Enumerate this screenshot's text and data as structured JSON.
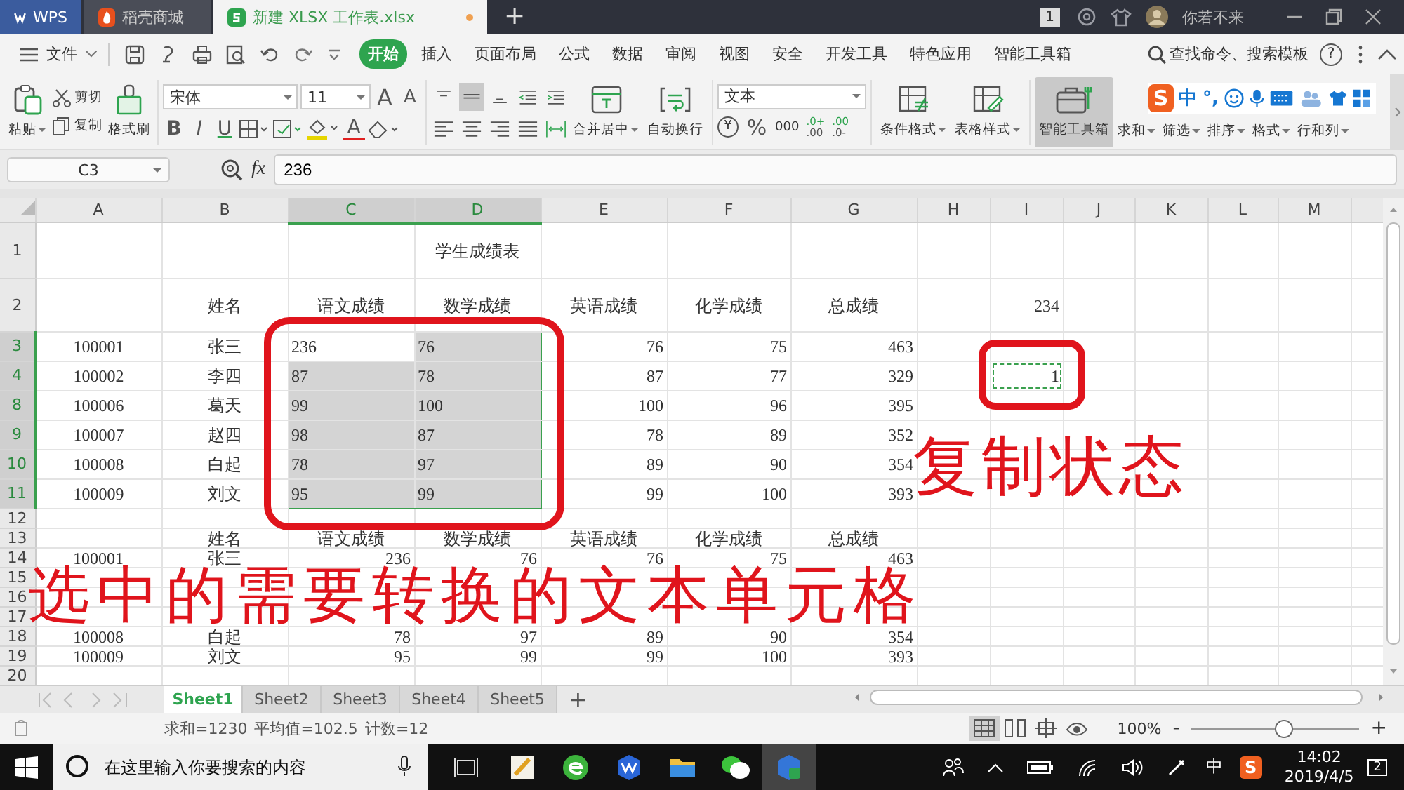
{
  "title_bar": {
    "tabs": [
      {
        "label": "WPS",
        "kind": "home",
        "selected": false
      },
      {
        "label": "稻壳商城",
        "kind": "store",
        "selected": false
      },
      {
        "label": "新建 XLSX 工作表.xlsx",
        "kind": "sheet",
        "selected": true,
        "modified": true
      }
    ],
    "new_tab": "+",
    "badge": "1",
    "user": "你若不来"
  },
  "menu": {
    "file": "文件",
    "tabs": [
      {
        "label": "开始",
        "selected": true
      },
      {
        "label": "插入",
        "selected": false
      },
      {
        "label": "页面布局",
        "selected": false
      },
      {
        "label": "公式",
        "selected": false
      },
      {
        "label": "数据",
        "selected": false
      },
      {
        "label": "审阅",
        "selected": false
      },
      {
        "label": "视图",
        "selected": false
      },
      {
        "label": "安全",
        "selected": false
      },
      {
        "label": "开发工具",
        "selected": false
      },
      {
        "label": "特色应用",
        "selected": false
      },
      {
        "label": "智能工具箱",
        "selected": false
      }
    ],
    "search": "查找命令、搜索模板",
    "help": "?"
  },
  "ribbon": {
    "paste": "粘贴",
    "cut": "剪切",
    "copy": "复制",
    "format_painter": "格式刷",
    "font": "宋体",
    "font_size": "11",
    "grow_font": "A",
    "shrink_font": "A",
    "style_buttons": [
      "B",
      "I",
      "U"
    ],
    "font_color": "A",
    "align_buttons": [
      {
        "selected": false
      },
      {
        "selected": true
      },
      {
        "selected": false
      },
      {
        "selected": false
      },
      {
        "selected": false
      }
    ],
    "merge": "合并居中",
    "wrap": "自动换行",
    "number_format": "文本",
    "currency": "¥",
    "percent": "%",
    "thousands": "000",
    "decimal_buttons": [
      {
        "top": ".0+",
        "bottom": ".00"
      },
      {
        "top": ".00",
        "bottom": ".0-"
      }
    ],
    "conditional": "条件格式",
    "table_style": "表格样式",
    "toolbox": {
      "label": "智能工具箱",
      "selected": true
    },
    "more": [
      "求和",
      "筛选",
      "排序",
      "格式",
      "行和列"
    ]
  },
  "ime_bar": {
    "logo": "S",
    "mode": "中",
    "punctuation": "°,"
  },
  "formula_bar": {
    "cell_name": "C3",
    "fx": "fx",
    "value": "236"
  },
  "sheet": {
    "columns": [
      {
        "label": "A",
        "selected": false
      },
      {
        "label": "B",
        "selected": false
      },
      {
        "label": "C",
        "selected": true
      },
      {
        "label": "D",
        "selected": true
      },
      {
        "label": "E",
        "selected": false
      },
      {
        "label": "F",
        "selected": false
      },
      {
        "label": "G",
        "selected": false
      },
      {
        "label": "H",
        "selected": false
      },
      {
        "label": "I",
        "selected": false
      },
      {
        "label": "J",
        "selected": false
      },
      {
        "label": "K",
        "selected": false
      },
      {
        "label": "L",
        "selected": false
      },
      {
        "label": "M",
        "selected": false
      }
    ],
    "rows": [
      {
        "header": "1",
        "kind": "title",
        "compact": false,
        "selected": false,
        "cells": [
          null,
          null,
          null,
          "学生成绩表"
        ]
      },
      {
        "header": "2",
        "kind": "header",
        "compact": false,
        "selected": false,
        "cells": [
          null,
          "姓名",
          "语文成绩",
          "数学成绩",
          "英语成绩",
          "化学成绩",
          "总成绩",
          null,
          {
            "text": "234",
            "kind": "number"
          }
        ]
      },
      {
        "header": "3",
        "kind": "data",
        "compact": false,
        "selected": true,
        "cells": [
          "100001",
          "张三",
          {
            "text": "236",
            "kind": "text"
          },
          {
            "text": "76",
            "kind": "text"
          },
          "76",
          "75",
          "463"
        ]
      },
      {
        "header": "4",
        "kind": "data",
        "compact": false,
        "selected": true,
        "cells": [
          "100002",
          "李四",
          {
            "text": "87",
            "kind": "text"
          },
          {
            "text": "78",
            "kind": "text"
          },
          "87",
          "77",
          "329",
          null,
          {
            "text": "1",
            "copied": true
          }
        ]
      },
      {
        "header": "8",
        "kind": "data",
        "compact": false,
        "selected": true,
        "cells": [
          "100006",
          "葛天",
          {
            "text": "99",
            "kind": "text"
          },
          {
            "text": "100",
            "kind": "text"
          },
          "100",
          "96",
          "395"
        ]
      },
      {
        "header": "9",
        "kind": "data",
        "compact": false,
        "selected": true,
        "cells": [
          "100007",
          "赵四",
          {
            "text": "98",
            "kind": "text"
          },
          {
            "text": "87",
            "kind": "text"
          },
          "78",
          "89",
          "352"
        ]
      },
      {
        "header": "10",
        "kind": "data",
        "compact": false,
        "selected": true,
        "cells": [
          "100008",
          "白起",
          {
            "text": "78",
            "kind": "text"
          },
          {
            "text": "97",
            "kind": "text"
          },
          "89",
          "90",
          "354"
        ]
      },
      {
        "header": "11",
        "kind": "data",
        "compact": false,
        "selected": true,
        "cells": [
          "100009",
          "刘文",
          {
            "text": "95",
            "kind": "text"
          },
          {
            "text": "99",
            "kind": "text"
          },
          "99",
          "100",
          "393"
        ]
      },
      {
        "header": "12",
        "kind": "data",
        "compact": true,
        "selected": false
      },
      {
        "header": "13",
        "kind": "header",
        "compact": true,
        "selected": false,
        "cells": [
          null,
          "姓名",
          "语文成绩",
          "数学成绩",
          "英语成绩",
          "化学成绩",
          "总成绩"
        ]
      },
      {
        "header": "14",
        "kind": "data",
        "compact": true,
        "selected": false,
        "cells": [
          "100001",
          "张三",
          "236",
          "76",
          "76",
          "75",
          "463"
        ]
      },
      {
        "header": "15",
        "kind": "data",
        "compact": true,
        "selected": false
      },
      {
        "header": "16",
        "kind": "data",
        "compact": true,
        "selected": false
      },
      {
        "header": "17",
        "kind": "data",
        "compact": true,
        "selected": false
      },
      {
        "header": "18",
        "kind": "data",
        "compact": true,
        "selected": false,
        "cells": [
          "100008",
          "白起",
          "78",
          "97",
          "89",
          "90",
          "354"
        ]
      },
      {
        "header": "19",
        "kind": "data",
        "compact": true,
        "selected": false,
        "cells": [
          "100009",
          "刘文",
          "95",
          "99",
          "99",
          "100",
          "393"
        ]
      },
      {
        "header": "20",
        "kind": "data",
        "compact": true,
        "selected": false
      }
    ]
  },
  "annotations": [
    "复制状态",
    "选中的需要转换的文本单元格"
  ],
  "sheet_tabs": {
    "tabs": [
      {
        "label": "Sheet1",
        "selected": true
      },
      {
        "label": "Sheet2",
        "selected": false
      },
      {
        "label": "Sheet3",
        "selected": false
      },
      {
        "label": "Sheet4",
        "selected": false
      },
      {
        "label": "Sheet5",
        "selected": false
      }
    ],
    "add": "+"
  },
  "status_bar": {
    "stats": [
      "求和=1230",
      "平均值=102.5",
      "计数=12"
    ],
    "views": [
      {
        "selected": true
      },
      {
        "selected": false
      },
      {
        "selected": false
      },
      {
        "selected": false
      }
    ],
    "zoom": "100%",
    "zoom_out": "-",
    "zoom_in": "+",
    "zoom_slider": {
      "level": 0.55
    }
  },
  "taskbar": {
    "search_placeholder": "在这里输入你要搜索的内容",
    "apps": [
      {
        "selected": false
      },
      {
        "selected": false
      },
      {
        "selected": false
      },
      {
        "selected": false
      },
      {
        "selected": false
      },
      {
        "selected": true
      }
    ],
    "ime": "中",
    "ime_logo": "S",
    "time": "14:02",
    "date": "2019/4/5",
    "notifications": "2"
  }
}
